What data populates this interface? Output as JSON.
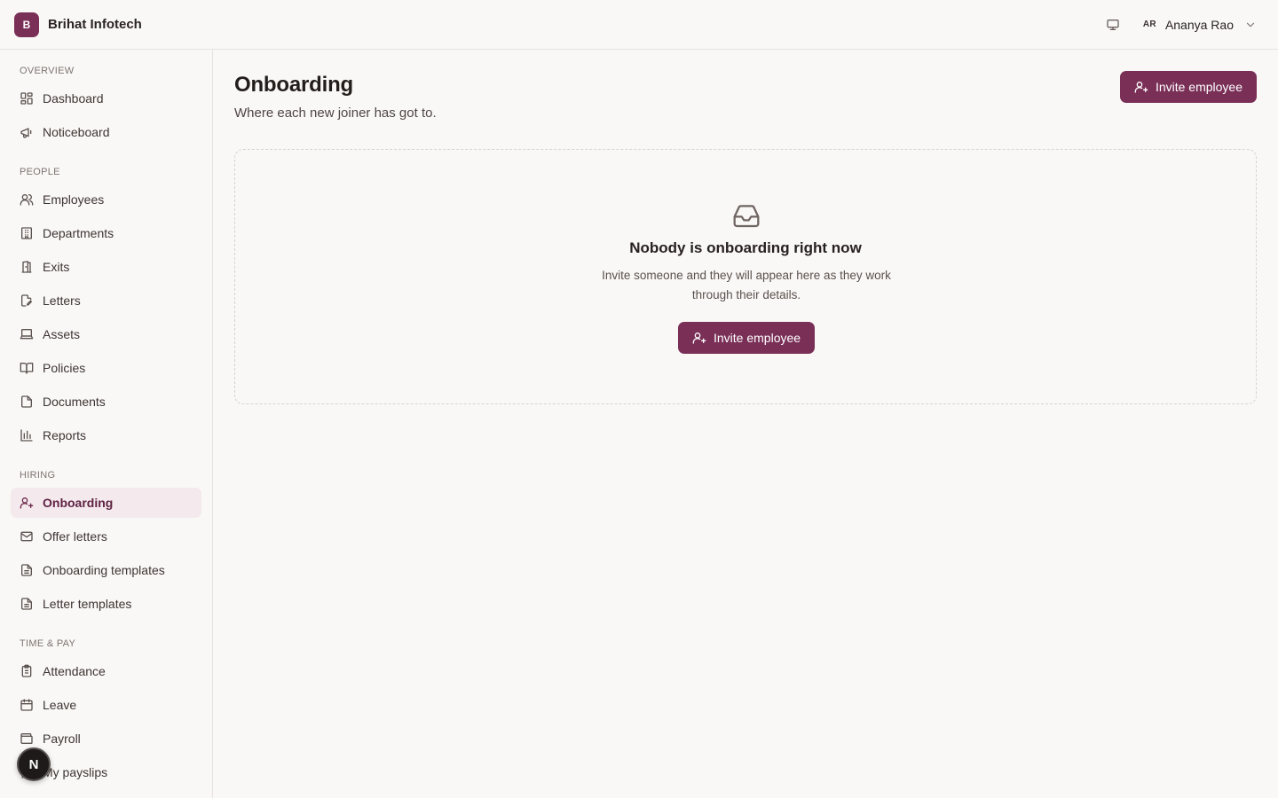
{
  "app": {
    "logo_letter": "B",
    "name": "Brihat Infotech",
    "accent_color": "#7a2f57"
  },
  "header": {
    "display_icon": "monitor-icon",
    "user_initials": "AR",
    "user_name": "Ananya Rao"
  },
  "sidebar": {
    "sections": [
      {
        "label": "OVERVIEW",
        "items": [
          {
            "label": "Dashboard",
            "icon": "dashboard-icon"
          },
          {
            "label": "Noticeboard",
            "icon": "megaphone-icon"
          }
        ]
      },
      {
        "label": "PEOPLE",
        "items": [
          {
            "label": "Employees",
            "icon": "users-icon"
          },
          {
            "label": "Departments",
            "icon": "building-icon"
          },
          {
            "label": "Exits",
            "icon": "door-icon"
          },
          {
            "label": "Letters",
            "icon": "file-edit-icon"
          },
          {
            "label": "Assets",
            "icon": "laptop-icon"
          },
          {
            "label": "Policies",
            "icon": "book-icon"
          },
          {
            "label": "Documents",
            "icon": "document-icon"
          },
          {
            "label": "Reports",
            "icon": "bar-chart-icon"
          }
        ]
      },
      {
        "label": "HIRING",
        "items": [
          {
            "label": "Onboarding",
            "icon": "user-plus-icon",
            "active": true
          },
          {
            "label": "Offer letters",
            "icon": "mail-icon"
          },
          {
            "label": "Onboarding templates",
            "icon": "file-text-icon"
          },
          {
            "label": "Letter templates",
            "icon": "file-text-icon"
          }
        ]
      },
      {
        "label": "TIME & PAY",
        "items": [
          {
            "label": "Attendance",
            "icon": "clipboard-icon"
          },
          {
            "label": "Leave",
            "icon": "calendar-icon"
          },
          {
            "label": "Payroll",
            "icon": "wallet-icon"
          },
          {
            "label": "My payslips",
            "icon": "receipt-icon"
          }
        ]
      }
    ],
    "fab_letter": "N"
  },
  "main": {
    "title": "Onboarding",
    "subtitle": "Where each new joiner has got to.",
    "invite_button_label": "Invite employee",
    "empty_state": {
      "icon": "inbox-icon",
      "title": "Nobody is onboarding right now",
      "text": "Invite someone and they will appear here as they work through their details.",
      "button_label": "Invite employee"
    }
  }
}
